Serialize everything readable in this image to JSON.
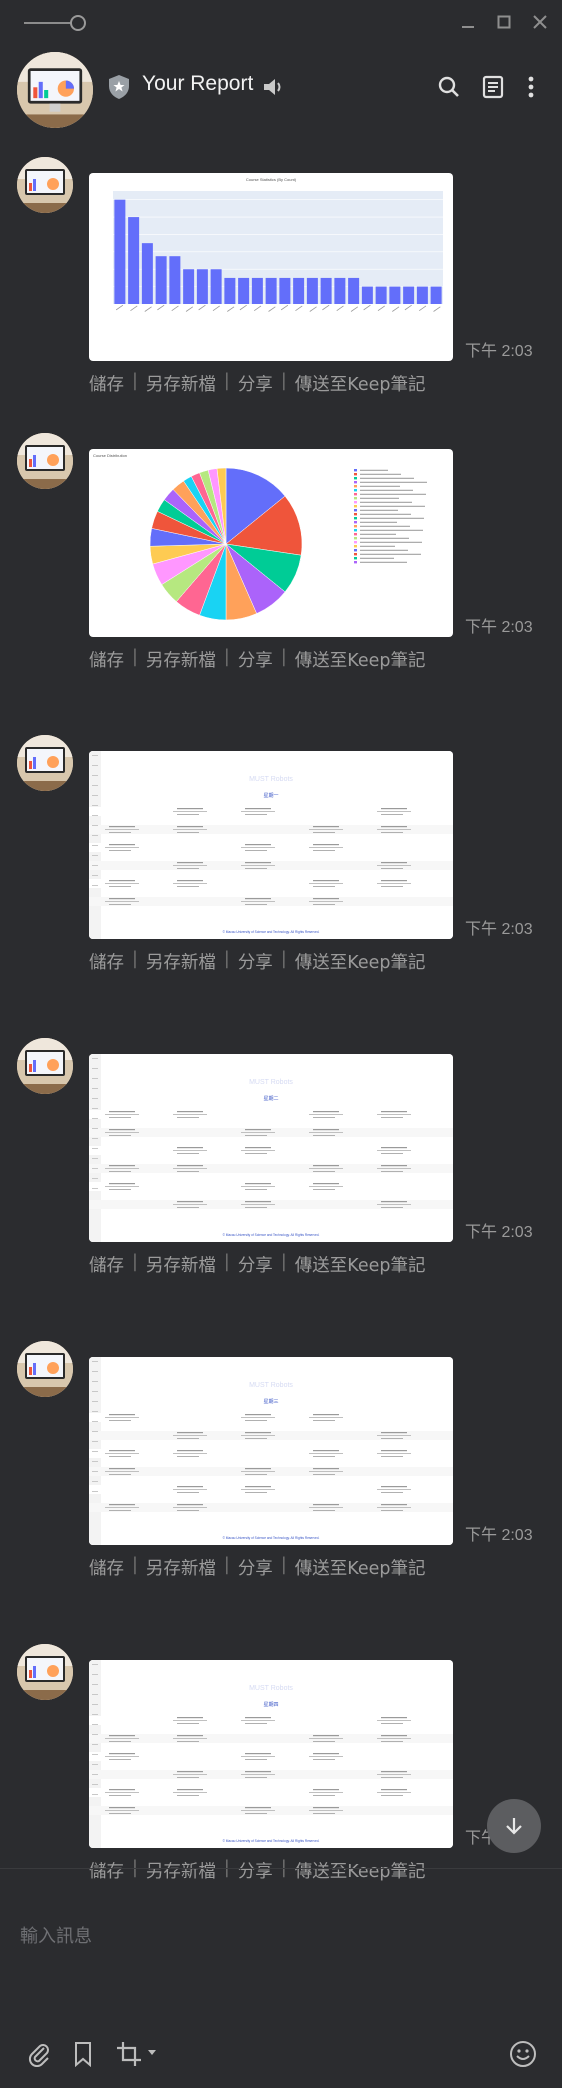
{
  "window": {
    "controls": [
      "minimize-icon",
      "maximize-icon",
      "close-icon"
    ]
  },
  "header": {
    "title": "Your Report",
    "icons": [
      "shield-star-icon",
      "speaker-icon",
      "search-icon",
      "notes-icon",
      "more-vertical-icon"
    ]
  },
  "messages": [
    {
      "kind": "bar-chart",
      "time": "下午 2:03",
      "chart_title": "Course Statistics (By Count)"
    },
    {
      "kind": "pie-chart",
      "time": "下午 2:03",
      "chart_title": "Course Distribution"
    },
    {
      "kind": "timetable",
      "time": "下午 2:03",
      "section_label": "星期一",
      "footer": "© Macau University of Science and Technology. All Rights Reserved."
    },
    {
      "kind": "timetable",
      "time": "下午 2:03",
      "section_label": "星期二",
      "footer": "© Macau University of Science and Technology. All Rights Reserved."
    },
    {
      "kind": "timetable",
      "time": "下午 2:03",
      "section_label": "星期三",
      "footer": "© Macau University of Science and Technology. All Rights Reserved."
    },
    {
      "kind": "timetable",
      "time": "下午 2:03",
      "section_label": "星期四",
      "footer": "© Macau University of Science and Technology. All Rights Reserved."
    }
  ],
  "actions": {
    "save": "儲存",
    "save_as": "另存新檔",
    "share": "分享",
    "send_keep": "傳送至Keep筆記",
    "separator": "|"
  },
  "composer": {
    "placeholder": "輸入訊息"
  },
  "chart_data": {
    "type": "bar",
    "title": "Course Statistics (By Count)",
    "values": [
      12,
      10,
      7,
      5.5,
      5.5,
      4,
      4,
      4,
      3,
      3,
      3,
      3,
      3,
      3,
      3,
      3,
      3,
      3,
      2,
      2,
      2,
      2,
      2,
      2
    ],
    "ylim": [
      0,
      13
    ],
    "grid": true
  },
  "colors": {
    "bar": "#636efa",
    "plot_bg": "#e5ecf6",
    "pie": [
      "#636efa",
      "#ef553b",
      "#00cc96",
      "#ab63fa",
      "#ffa15a",
      "#19d3f3",
      "#ff6692",
      "#b6e880",
      "#ff97ff",
      "#fecb52"
    ]
  }
}
